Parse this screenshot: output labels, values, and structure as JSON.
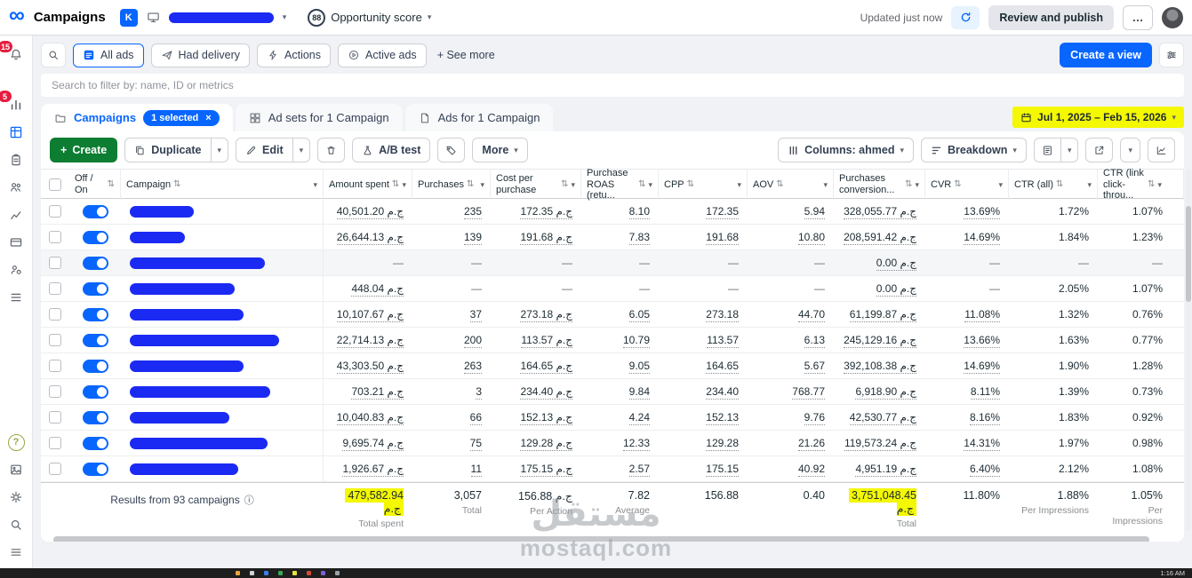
{
  "colors": {
    "accent": "#0866ff",
    "create_green": "#0d7d32",
    "highlight_yellow": "#f4f800",
    "redaction_blue": "#1b2af2"
  },
  "topbar": {
    "title": "Campaigns",
    "account_key": "K",
    "opportunity_score": "88",
    "opportunity_label": "Opportunity score",
    "updated": "Updated just now",
    "review_button": "Review and publish",
    "ellipsis": "…"
  },
  "sidebar": {
    "badges": [
      "15",
      "5"
    ]
  },
  "filters": {
    "pills": [
      {
        "label": "All ads"
      },
      {
        "label": "Had delivery"
      },
      {
        "label": "Actions"
      },
      {
        "label": "Active ads"
      }
    ],
    "see_more": "+ See more",
    "create_view": "Create a view",
    "search_placeholder": "Search to filter by: name, ID or metrics"
  },
  "tabs": {
    "campaigns": {
      "label": "Campaigns",
      "badge": "1 selected",
      "close": "×"
    },
    "ad_sets": {
      "label": "Ad sets for 1 Campaign"
    },
    "ads": {
      "label": "Ads for 1 Campaign"
    },
    "date_range": "Jul 1, 2025 – Feb 15, 2026"
  },
  "toolbar": {
    "create": "Create",
    "duplicate": "Duplicate",
    "edit": "Edit",
    "ab_test": "A/B test",
    "more": "More",
    "columns": "Columns: ahmed",
    "breakdown": "Breakdown"
  },
  "table": {
    "toggle_column": {
      "label": "Off / On"
    },
    "campaign_column": {
      "label": "Campaign"
    },
    "metric_columns": [
      {
        "key": "amount_spent",
        "label": "Amount spent"
      },
      {
        "key": "purchases",
        "label": "Purchases"
      },
      {
        "key": "cost_per_purchase",
        "label": "Cost per purchase"
      },
      {
        "key": "purchase_roas",
        "label": "Purchase ROAS (retu..."
      },
      {
        "key": "cpp",
        "label": "CPP"
      },
      {
        "key": "aov",
        "label": "AOV"
      },
      {
        "key": "purchases_conversion",
        "label": "Purchases conversion..."
      },
      {
        "key": "cvr",
        "label": "CVR"
      },
      {
        "key": "ctr_all",
        "label": "CTR (all)"
      },
      {
        "key": "ctr_link",
        "label": "CTR (link click-throu..."
      }
    ],
    "rows": [
      {
        "on": true,
        "redact_w": 72,
        "values": [
          "40,501.20 ج.م",
          "235",
          "172.35 ج.م",
          "8.10",
          "172.35",
          "5.94",
          "328,055.77 ج.م",
          "13.69%",
          "1.72%",
          "1.07%"
        ]
      },
      {
        "on": true,
        "redact_w": 62,
        "values": [
          "26,644.13 ج.م",
          "139",
          "191.68 ج.م",
          "7.83",
          "191.68",
          "10.80",
          "208,591.42 ج.م",
          "14.69%",
          "1.84%",
          "1.23%"
        ]
      },
      {
        "on": true,
        "redact_w": 152,
        "tinted": true,
        "values": [
          "—",
          "—",
          "—",
          "—",
          "—",
          "—",
          "0.00 ج.م",
          "—",
          "—",
          "—"
        ]
      },
      {
        "on": true,
        "redact_w": 118,
        "values": [
          "448.04 ج.م",
          "—",
          "—",
          "—",
          "—",
          "—",
          "0.00 ج.م",
          "—",
          "2.05%",
          "1.07%"
        ]
      },
      {
        "on": true,
        "redact_w": 128,
        "values": [
          "10,107.67 ج.م",
          "37",
          "273.18 ج.م",
          "6.05",
          "273.18",
          "44.70",
          "61,199.87 ج.م",
          "11.08%",
          "1.32%",
          "0.76%"
        ]
      },
      {
        "on": true,
        "redact_w": 168,
        "values": [
          "22,714.13 ج.م",
          "200",
          "113.57 ج.م",
          "10.79",
          "113.57",
          "6.13",
          "245,129.16 ج.م",
          "13.66%",
          "1.63%",
          "0.77%"
        ]
      },
      {
        "on": true,
        "redact_w": 128,
        "values": [
          "43,303.50 ج.م",
          "263",
          "164.65 ج.م",
          "9.05",
          "164.65",
          "5.67",
          "392,108.38 ج.م",
          "14.69%",
          "1.90%",
          "1.28%"
        ]
      },
      {
        "on": true,
        "redact_w": 158,
        "values": [
          "703.21 ج.م",
          "3",
          "234.40 ج.م",
          "9.84",
          "234.40",
          "768.77",
          "6,918.90 ج.م",
          "8.11%",
          "1.39%",
          "0.73%"
        ]
      },
      {
        "on": true,
        "redact_w": 112,
        "values": [
          "10,040.83 ج.م",
          "66",
          "152.13 ج.م",
          "4.24",
          "152.13",
          "9.76",
          "42,530.77 ج.م",
          "8.16%",
          "1.83%",
          "0.92%"
        ]
      },
      {
        "on": true,
        "redact_w": 155,
        "values": [
          "9,695.74 ج.م",
          "75",
          "129.28 ج.م",
          "12.33",
          "129.28",
          "21.26",
          "119,573.24 ج.م",
          "14.31%",
          "1.97%",
          "0.98%"
        ]
      },
      {
        "on": true,
        "redact_w": 122,
        "values": [
          "1,926.67 ج.م",
          "11",
          "175.15 ج.م",
          "2.57",
          "175.15",
          "40.92",
          "4,951.19 ج.م",
          "6.40%",
          "2.12%",
          "1.08%"
        ]
      }
    ],
    "footer": {
      "results_label": "Results from 93 campaigns",
      "totals": [
        {
          "value": "479,582.94 ج.م",
          "sub": "Total spent",
          "highlight": true
        },
        {
          "value": "3,057",
          "sub": "Total"
        },
        {
          "value": "156.88 ج.م",
          "sub": "Per Action"
        },
        {
          "value": "7.82",
          "sub": "Average"
        },
        {
          "value": "156.88",
          "sub": ""
        },
        {
          "value": "0.40",
          "sub": ""
        },
        {
          "value": "3,751,048.45 ج.م",
          "sub": "Total",
          "highlight": true
        },
        {
          "value": "11.80%",
          "sub": ""
        },
        {
          "value": "1.88%",
          "sub": "Per Impressions"
        },
        {
          "value": "1.05%",
          "sub": "Per Impressions"
        }
      ]
    }
  },
  "watermark": {
    "arabic": "مستقل",
    "latin": "mostaql.com"
  },
  "taskbar": {
    "time": "1:16 AM"
  }
}
